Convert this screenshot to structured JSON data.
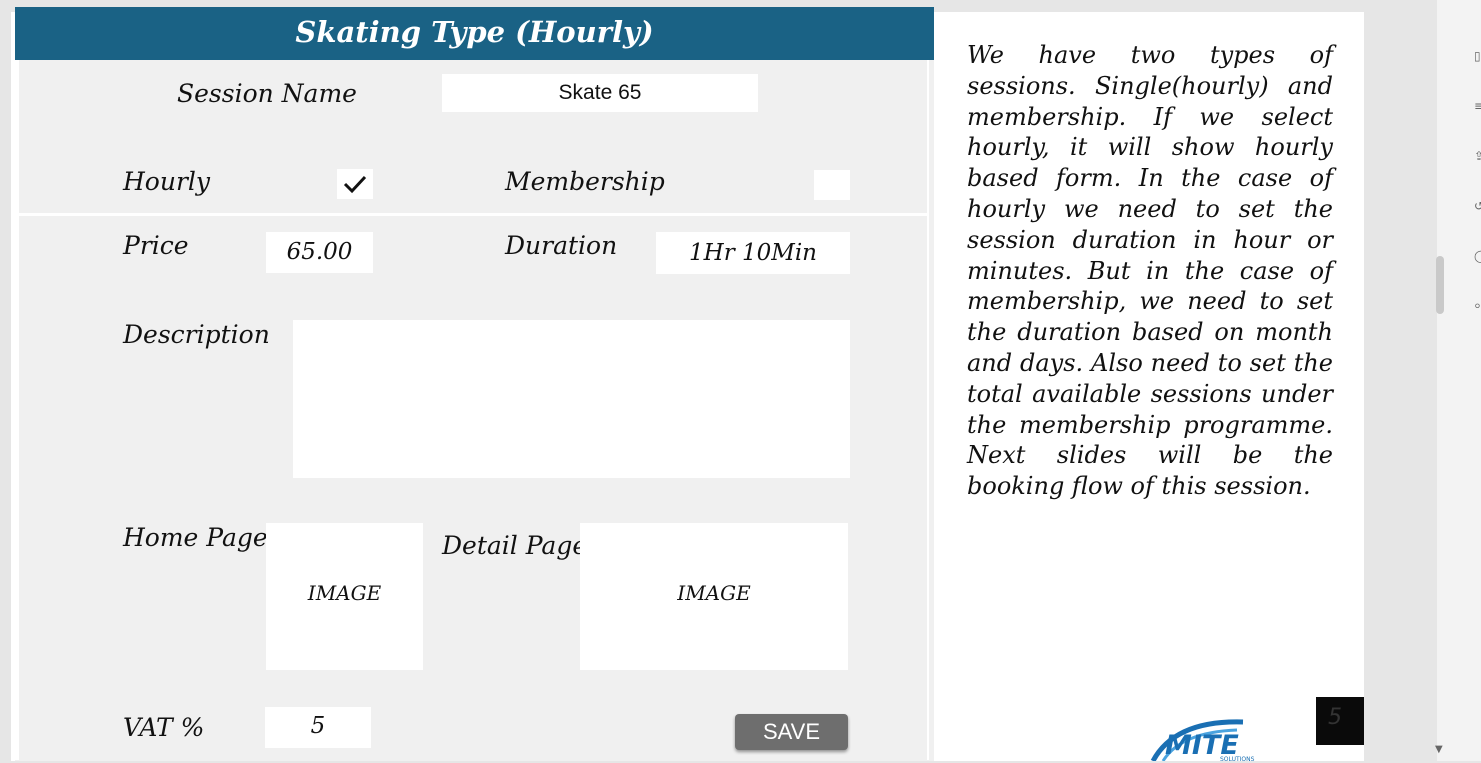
{
  "form": {
    "title": "Skating Type (Hourly)",
    "session_name_label": "Session Name",
    "session_name_value": "Skate 65",
    "hourly_label": "Hourly",
    "hourly_checked": true,
    "membership_label": "Membership",
    "membership_checked": false,
    "price_label": "Price",
    "price_value": "65.00",
    "duration_label": "Duration",
    "duration_value": "1Hr 10Min",
    "description_label": "Description",
    "description_value": "",
    "home_page_label": "Home Page",
    "home_image_text": "IMAGE",
    "detail_page_label": "Detail Page",
    "detail_image_text": "IMAGE",
    "vat_label": "VAT %",
    "vat_value": "5",
    "save_label": "SAVE"
  },
  "note": {
    "text": "We have two types of sessions. Single(hourly) and membership. If we select hourly, it will show hourly based form. In the case of hourly we need to set the session duration in hour or minutes. But in the case of membership, we need to set the duration based on month and days. Also need to set the total available sessions under the membership programme. Next slides will be the booking flow of this session."
  },
  "slide": {
    "page_number": "5",
    "logo_text": "MITE",
    "logo_subtext": "SOLUTIONS"
  },
  "colors": {
    "header": "#1a6285",
    "panel": "#f0f0f0",
    "save_button": "#6e6e6e",
    "logo": "#1a6fb3"
  },
  "icons": [
    "check-icon",
    "chevron-down-icon"
  ]
}
